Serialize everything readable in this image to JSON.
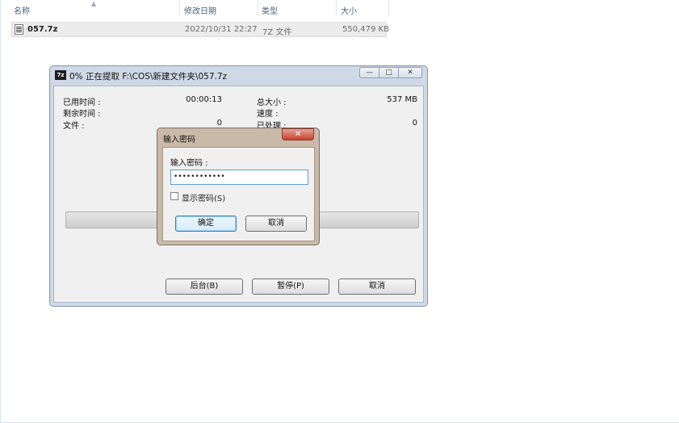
{
  "explorer": {
    "columns": [
      "名称",
      "修改日期",
      "类型",
      "大小"
    ],
    "file": {
      "name": "057.7z",
      "modified": "2022/10/31 22:27",
      "type": "7Z 文件",
      "size": "550,479 KB"
    }
  },
  "progress_window": {
    "icon_label": "7z",
    "title": "0% 正在提取 F:\\COS\\新建文件夹\\057.7z",
    "controls": {
      "min": "—",
      "max": "□",
      "close": "✕"
    },
    "stats_left": [
      {
        "label": "已用时间 :",
        "value": "00:00:13"
      },
      {
        "label": "剩余时间 :",
        "value": ""
      },
      {
        "label": "文件 :",
        "value": "0"
      }
    ],
    "stats_right": [
      {
        "label": "总大小 :",
        "value": "537 MB"
      },
      {
        "label": "速度 :",
        "value": ""
      },
      {
        "label": "已处理 :",
        "value": "0"
      }
    ],
    "progress_percent": 0,
    "buttons": {
      "background": "后台(B)",
      "pause": "暂停(P)",
      "cancel": "取消"
    }
  },
  "password_dialog": {
    "title": "输入密码",
    "close": "✕",
    "prompt": "输入密码 :",
    "password_value": "••••••••••••",
    "show_password_label": "显示密码(S)",
    "show_password_checked": false,
    "ok": "确定",
    "cancel": "取消"
  }
}
